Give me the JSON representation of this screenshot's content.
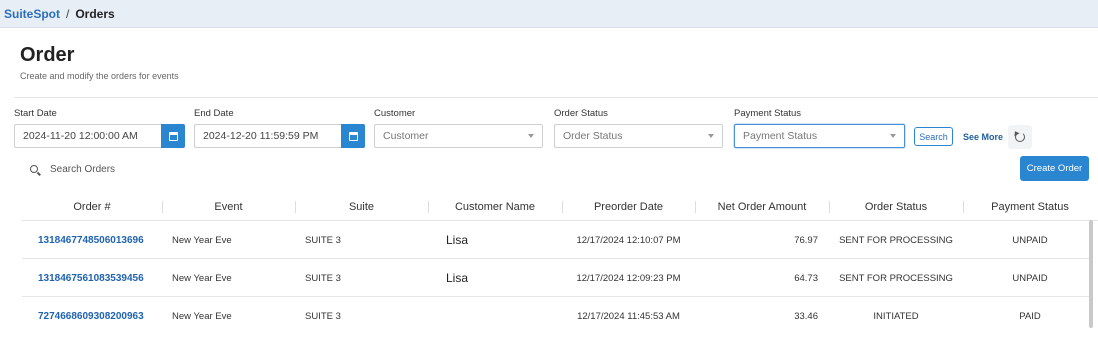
{
  "breadcrumb": {
    "root": "SuiteSpot",
    "separator": "/",
    "current": "Orders"
  },
  "page": {
    "title": "Order",
    "subtitle": "Create and modify the orders for events"
  },
  "filters": {
    "start_date": {
      "label": "Start Date",
      "value": "2024-11-20 12:00:00 AM"
    },
    "end_date": {
      "label": "End Date",
      "value": "2024-12-20 11:59:59 PM"
    },
    "customer": {
      "label": "Customer",
      "placeholder": "Customer"
    },
    "order_status": {
      "label": "Order Status",
      "placeholder": "Order Status"
    },
    "payment_status": {
      "label": "Payment Status",
      "placeholder": "Payment Status"
    },
    "search_label": "Search",
    "see_more_label": "See More"
  },
  "search": {
    "placeholder": "Search Orders"
  },
  "create_label": "Create Order",
  "table": {
    "columns": [
      "Order #",
      "Event",
      "Suite",
      "Customer Name",
      "Preorder Date",
      "Net Order Amount",
      "Order Status",
      "Payment Status"
    ],
    "rows": [
      {
        "order": "1318467748506013696",
        "event": "New Year Eve",
        "suite": "SUITE 3",
        "customer": "Lisa",
        "date": "12/17/2024 12:10:07 PM",
        "amount": "76.97",
        "order_status": "SENT FOR PROCESSING",
        "payment_status": "UNPAID"
      },
      {
        "order": "1318467561083539456",
        "event": "New Year Eve",
        "suite": "SUITE 3",
        "customer": "Lisa",
        "date": "12/17/2024 12:09:23 PM",
        "amount": "64.73",
        "order_status": "SENT FOR PROCESSING",
        "payment_status": "UNPAID"
      },
      {
        "order": "7274668609308200963",
        "event": "New Year Eve",
        "suite": "SUITE 3",
        "customer": "",
        "date": "12/17/2024 11:45:53 AM",
        "amount": "33.46",
        "order_status": "INITIATED",
        "payment_status": "PAID"
      }
    ]
  },
  "colors": {
    "accent": "#2a86d1",
    "link": "#1f63b0",
    "topbar": "#e8eef6"
  },
  "icons": {
    "calendar": "calendar-icon",
    "search": "search-icon",
    "reset": "reset-icon",
    "dropdown": "chevron-down-icon"
  }
}
